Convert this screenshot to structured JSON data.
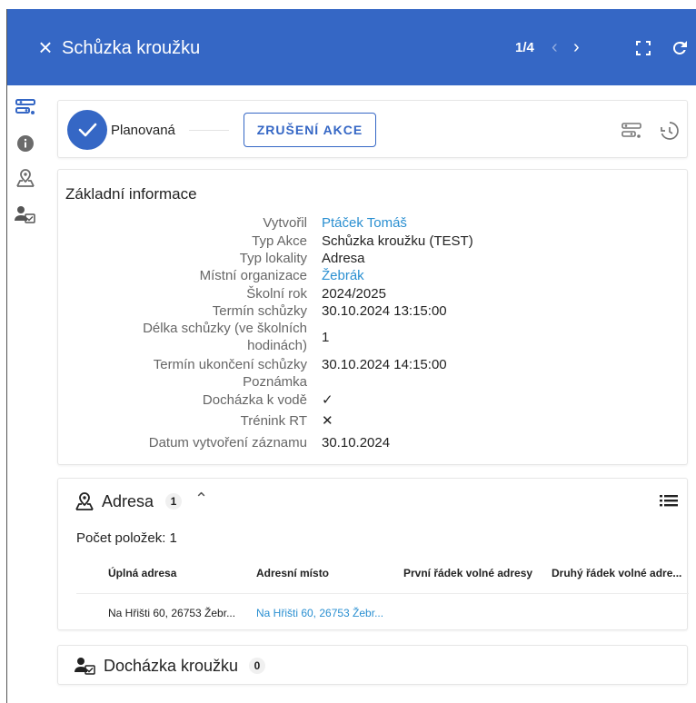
{
  "header": {
    "title": "Schůzka kroužku",
    "pager": "1/4",
    "prev_icon": "‹",
    "next_icon": "›",
    "close_icon": "×"
  },
  "status": {
    "label": "Planovaná",
    "cancel_label": "ZRUŠENÍ AKCE"
  },
  "info": {
    "title": "Základní informace",
    "rows": [
      {
        "label": "Vytvořil",
        "value": "Ptáček Tomáš",
        "link": true
      },
      {
        "label": "Typ Akce",
        "value": "Schůzka kroužku (TEST)"
      },
      {
        "label": "Typ lokality",
        "value": "Adresa"
      },
      {
        "label": "Místní organizace",
        "value": "Žebrák",
        "link": true
      },
      {
        "label": "Školní rok",
        "value": "2024/2025"
      },
      {
        "label": "Termín schůzky",
        "value": "30.10.2024 13:15:00"
      },
      {
        "label_line1": "Délka schůzky (ve školních",
        "label_line2": "hodinách)",
        "value": "1"
      },
      {
        "label": "Termín ukončení schůzky",
        "value": "30.10.2024 14:15:00"
      },
      {
        "label": "Poznámka",
        "value": ""
      },
      {
        "label": "Docházka k vodě",
        "value": "✓"
      },
      {
        "label": "Trénink RT",
        "value": "✕"
      },
      {
        "label": "Datum vytvoření záznamu",
        "value": "30.10.2024"
      }
    ]
  },
  "address": {
    "title": "Adresa",
    "count": "1",
    "chevron": "⌃",
    "items_count": "Počet položek: 1",
    "columns": [
      "Úplná adresa",
      "Adresní místo",
      "První řádek volné adresy",
      "Druhý řádek volné adre..."
    ],
    "rows": [
      {
        "full": "Na Hřišti 60, 26753 Žebr...",
        "place": "Na Hřišti 60, 26753 Žebr..."
      }
    ]
  },
  "attendance": {
    "title": "Docházka kroužku",
    "count": "0"
  },
  "colors": {
    "brand": "#3567c5",
    "link": "#2a8fd1"
  }
}
